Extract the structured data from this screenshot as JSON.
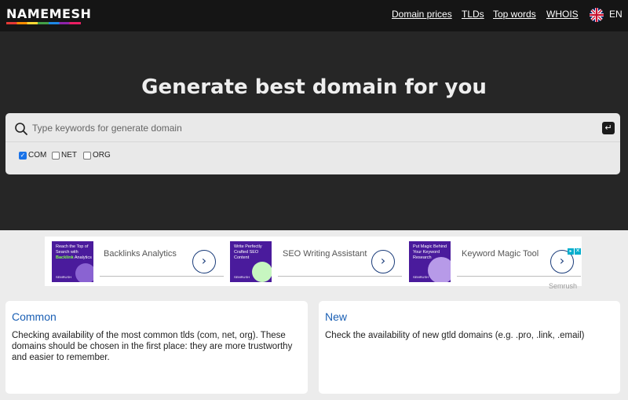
{
  "header": {
    "logo": "NAMEMESH",
    "nav": [
      "Domain prices",
      "TLDs",
      "Top words",
      "WHOIS"
    ],
    "language": "EN"
  },
  "hero": {
    "title": "Generate best domain for you",
    "search_placeholder": "Type keywords for generate domain",
    "enter_icon": "enter-icon",
    "tlds": [
      {
        "label": "COM",
        "checked": true
      },
      {
        "label": "NET",
        "checked": false
      },
      {
        "label": "ORG",
        "checked": false
      }
    ]
  },
  "ads": {
    "items": [
      {
        "image_text": "Reach the Top of Search with Backlink Analytics",
        "image_highlight": "Backlink",
        "title": "Backlinks Analytics"
      },
      {
        "image_text": "Write Perfectly Crafted SEO Content",
        "title": "SEO Writing Assistant"
      },
      {
        "image_text": "Put Magic Behind Your Keyword Research",
        "title": "Keyword Magic Tool"
      }
    ],
    "brand": "Semrush",
    "image_logo": "SEMRUSH"
  },
  "cards": [
    {
      "title": "Common",
      "text": "Checking availability of the most common tlds (com, net, org). These domains should be chosen in the first place: they are more trustworthy and easier to remember."
    },
    {
      "title": "New",
      "text": "Check the availability of new gtld domains (e.g. .pro, .link, .email)"
    }
  ],
  "colors": {
    "topbar": "#151515",
    "hero": "#262626",
    "link_blue": "#1a5fb4",
    "ad_purple": "#4a1b9c",
    "checkbox_blue": "#1a73e8"
  }
}
